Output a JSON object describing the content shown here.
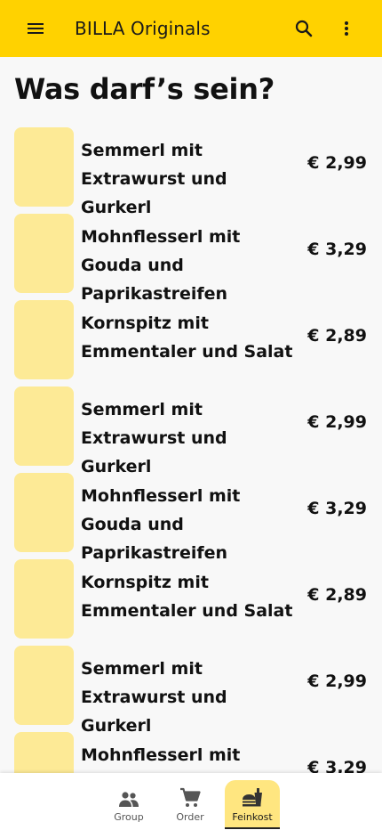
{
  "appbar": {
    "title": "BILLA Originals",
    "background": "#ffd200",
    "icons": [
      "menu-icon",
      "search-icon",
      "more-vert-icon"
    ]
  },
  "page_title": "Was darf’s sein?",
  "items": [
    {
      "name": "Semmerl mit Extrawurst und Gurkerl",
      "price": "€ 2,99"
    },
    {
      "name": "Mohnflesserl mit Gouda und Paprikastreifen",
      "price": "€ 3,29"
    },
    {
      "name": "Kornspitz mit Emmentaler und Salat",
      "price": "€ 2,89"
    },
    {
      "name": "Semmerl mit Extrawurst und Gurkerl",
      "price": "€ 2,99"
    },
    {
      "name": "Mohnflesserl mit Gouda und Paprikastreifen",
      "price": "€ 3,29"
    },
    {
      "name": "Kornspitz mit Emmentaler und Salat",
      "price": "€ 2,89"
    },
    {
      "name": "Semmerl mit Extrawurst und Gurkerl",
      "price": "€ 2,99"
    },
    {
      "name": "Mohnflesserl mit Gouda und Paprikastreifen",
      "price": "€ 3,29"
    }
  ],
  "thumb_color": "#fdea96",
  "bottom_nav": {
    "items": [
      {
        "label": "Group",
        "icon": "group-icon",
        "selected": false
      },
      {
        "label": "Order",
        "icon": "cart-icon",
        "selected": false
      },
      {
        "label": "Feinkost",
        "icon": "food-icon",
        "selected": true
      }
    ],
    "selected_color": "#ffe680"
  }
}
